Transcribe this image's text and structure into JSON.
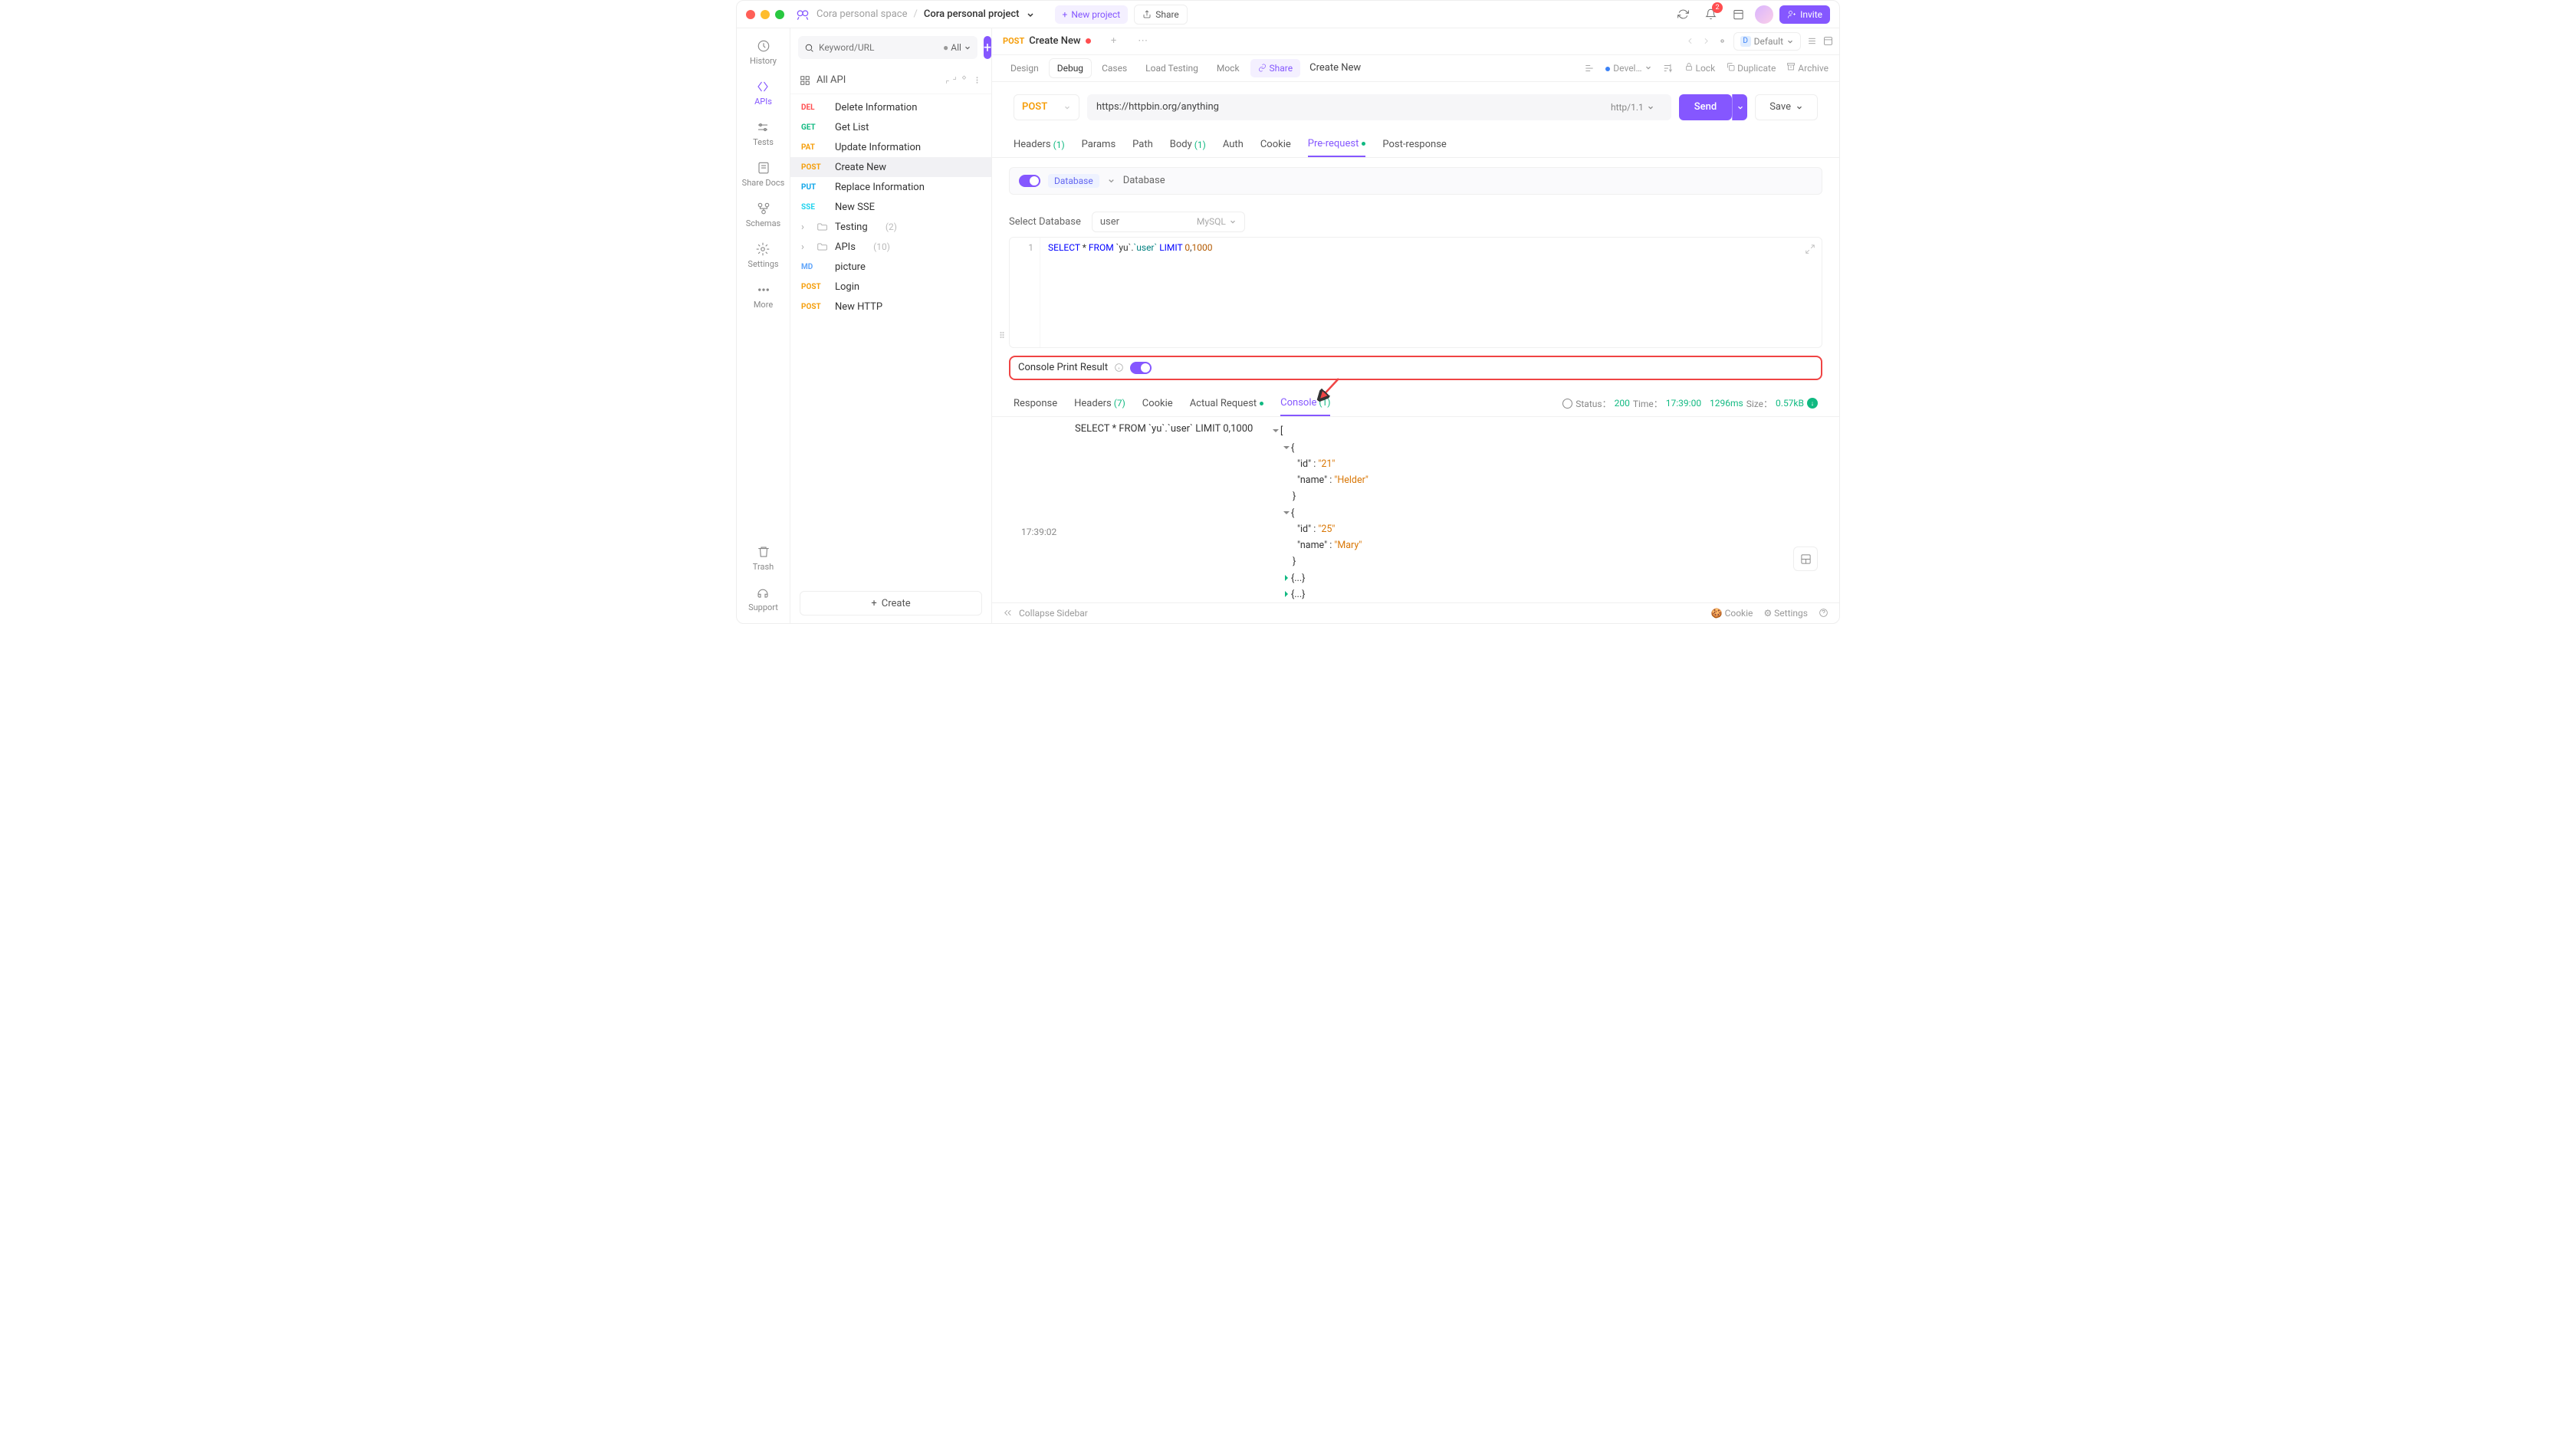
{
  "titlebar": {
    "workspace": "Cora personal space",
    "project": "Cora personal project",
    "new_project": "New project",
    "share": "Share",
    "invite": "Invite",
    "notif_count": "2"
  },
  "rail": [
    {
      "label": "History"
    },
    {
      "label": "APIs"
    },
    {
      "label": "Tests"
    },
    {
      "label": "Share Docs"
    },
    {
      "label": "Schemas"
    },
    {
      "label": "Settings"
    },
    {
      "label": "More"
    },
    {
      "label": "Trash"
    },
    {
      "label": "Support"
    }
  ],
  "sidebar": {
    "search_placeholder": "Keyword/URL",
    "filter": "All",
    "all_api": "All API",
    "items": [
      {
        "method": "DEL",
        "cls": "m-del",
        "label": "Delete Information"
      },
      {
        "method": "GET",
        "cls": "m-get",
        "label": "Get List"
      },
      {
        "method": "PAT",
        "cls": "m-pat",
        "label": "Update Information"
      },
      {
        "method": "POST",
        "cls": "m-post",
        "label": "Create New",
        "sel": true
      },
      {
        "method": "PUT",
        "cls": "m-put",
        "label": "Replace Information"
      },
      {
        "method": "SSE",
        "cls": "m-sse",
        "label": "New SSE"
      }
    ],
    "folders": [
      {
        "label": "Testing",
        "count": "(2)"
      },
      {
        "label": "APIs",
        "count": "(10)"
      }
    ],
    "extras": [
      {
        "method": "MD",
        "cls": "m-md",
        "label": "picture"
      },
      {
        "method": "POST",
        "cls": "m-post",
        "label": "Login"
      },
      {
        "method": "POST",
        "cls": "m-post",
        "label": "New HTTP"
      }
    ],
    "create": "Create"
  },
  "tab": {
    "method": "POST",
    "label": "Create New"
  },
  "env": "Default",
  "subtabs": {
    "design": "Design",
    "debug": "Debug",
    "cases": "Cases",
    "load": "Load Testing",
    "mock": "Mock",
    "share": "Share",
    "title": "Create New"
  },
  "subright": {
    "env": "Devel…",
    "lock": "Lock",
    "dup": "Duplicate",
    "arch": "Archive"
  },
  "request": {
    "method": "POST",
    "url": "https://httpbin.org/anything",
    "proto": "http/1.1",
    "send": "Send",
    "save": "Save"
  },
  "reqtabs": {
    "headers": "Headers",
    "headers_n": "(1)",
    "params": "Params",
    "path": "Path",
    "body": "Body",
    "body_n": "(1)",
    "auth": "Auth",
    "cookie": "Cookie",
    "pre": "Pre-request",
    "post": "Post-response"
  },
  "pre": {
    "chip": "Database",
    "label": "Database",
    "sel_label": "Select Database",
    "sel_val": "user",
    "sel_type": "MySQL"
  },
  "sql": {
    "line": "1",
    "code_html": "SELECT * FROM `yu`.`user` LIMIT 0,1000"
  },
  "console_print": {
    "label": "Console Print Result"
  },
  "resp_tabs": {
    "response": "Response",
    "headers": "Headers",
    "headers_n": "(7)",
    "cookie": "Cookie",
    "actual": "Actual Request",
    "console": "Console",
    "console_n": "(1)"
  },
  "stats": {
    "status_l": "Status：",
    "status_v": "200",
    "time_l": "Time：",
    "time_v": "17:39:00",
    "dur": "1296ms",
    "size_l": "Size：",
    "size_v": "0.57kB"
  },
  "console": {
    "query": "SELECT * FROM `yu`.`user` LIMIT 0,1000",
    "time": "17:39:02",
    "rows": [
      {
        "id": "\"21\"",
        "name": "\"Helder\""
      },
      {
        "id": "\"25\"",
        "name": "\"Mary\""
      }
    ],
    "collapsed": "{...}"
  },
  "footer": {
    "collapse": "Collapse Sidebar",
    "cookie": "Cookie",
    "settings": "Settings"
  }
}
